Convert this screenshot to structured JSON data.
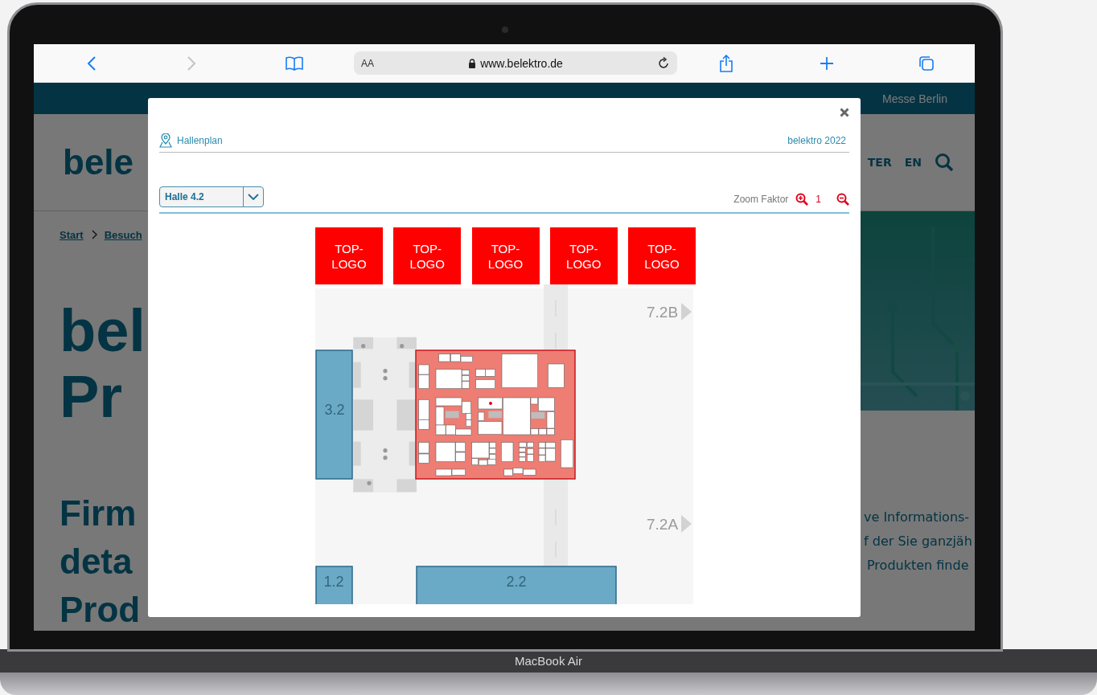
{
  "browser": {
    "text_size": "AA",
    "url": "www.belektro.de"
  },
  "website": {
    "header_brand": "Messe Berlin",
    "logo": "bele",
    "nav": [
      "TER",
      "EN"
    ],
    "breadcrumb": [
      "Start",
      "Besuch"
    ],
    "headline": [
      "bel",
      "Pr"
    ],
    "subheadline": [
      "Firm",
      "deta",
      "Prod"
    ],
    "intro": [
      "ve Informations-",
      "f der Sie ganzjäh",
      "Produkten finde"
    ]
  },
  "modal": {
    "title": "Hallenplan",
    "event": "belektro 2022",
    "hall_select": {
      "value": "Halle 4.2"
    },
    "zoom": {
      "label": "Zoom Faktor",
      "value": "1"
    },
    "top_logos": [
      "TOP-LOGO",
      "TOP-LOGO",
      "TOP-LOGO",
      "TOP-LOGO",
      "TOP-LOGO"
    ],
    "halls": [
      {
        "label": "7.2B",
        "kind": "direction"
      },
      {
        "label": "3.2",
        "kind": "hall"
      },
      {
        "label": "7.2A",
        "kind": "direction"
      },
      {
        "label": "1.2",
        "kind": "hall"
      },
      {
        "label": "2.2",
        "kind": "hall"
      }
    ]
  },
  "device": {
    "label": "MacBook Air"
  }
}
